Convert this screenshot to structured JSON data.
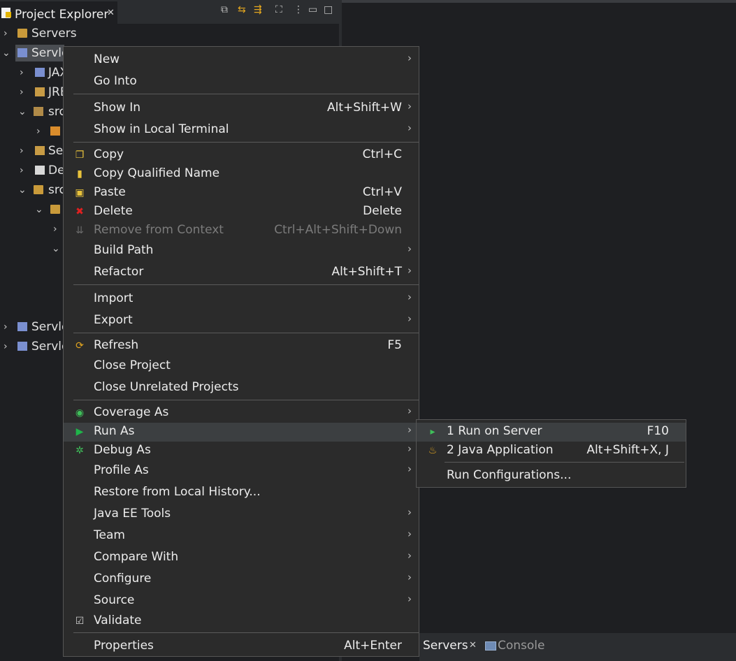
{
  "explorer": {
    "tab_label": "Project Explorer",
    "tree": [
      {
        "label": "Servers",
        "chev": "›"
      },
      {
        "label": "Servle",
        "chev": "⌄"
      },
      {
        "label": "JAX",
        "chev": "›"
      },
      {
        "label": "JRE",
        "chev": "›"
      },
      {
        "label": "src",
        "chev": "⌄"
      },
      {
        "label": "",
        "chev": "›"
      },
      {
        "label": "Se",
        "chev": "›"
      },
      {
        "label": "De",
        "chev": "›"
      },
      {
        "label": "src",
        "chev": "⌄"
      },
      {
        "label": "",
        "chev": "⌄"
      },
      {
        "label": "",
        "chev": "›"
      },
      {
        "label": "",
        "chev": "⌄"
      },
      {
        "label": "Servle",
        "chev": "›"
      },
      {
        "label": "Servle",
        "chev": "›"
      }
    ]
  },
  "context_menu": {
    "items": [
      {
        "label": "New",
        "shortcut": "",
        "arrow": "›"
      },
      {
        "label": "Go Into",
        "shortcut": "",
        "arrow": ""
      },
      {
        "label": "Show In",
        "shortcut": "Alt+Shift+W",
        "arrow": "›"
      },
      {
        "label": "Show in Local Terminal",
        "shortcut": "",
        "arrow": "›"
      },
      {
        "label": "Copy",
        "shortcut": "Ctrl+C",
        "arrow": ""
      },
      {
        "label": "Copy Qualified Name",
        "shortcut": "",
        "arrow": ""
      },
      {
        "label": "Paste",
        "shortcut": "Ctrl+V",
        "arrow": ""
      },
      {
        "label": "Delete",
        "shortcut": "Delete",
        "arrow": ""
      },
      {
        "label": "Remove from Context",
        "shortcut": "Ctrl+Alt+Shift+Down",
        "arrow": ""
      },
      {
        "label": "Build Path",
        "shortcut": "",
        "arrow": "›"
      },
      {
        "label": "Refactor",
        "shortcut": "Alt+Shift+T",
        "arrow": "›"
      },
      {
        "label": "Import",
        "shortcut": "",
        "arrow": "›"
      },
      {
        "label": "Export",
        "shortcut": "",
        "arrow": "›"
      },
      {
        "label": "Refresh",
        "shortcut": "F5",
        "arrow": ""
      },
      {
        "label": "Close Project",
        "shortcut": "",
        "arrow": ""
      },
      {
        "label": "Close Unrelated Projects",
        "shortcut": "",
        "arrow": ""
      },
      {
        "label": "Coverage As",
        "shortcut": "",
        "arrow": "›"
      },
      {
        "label": "Run As",
        "shortcut": "",
        "arrow": "›"
      },
      {
        "label": "Debug As",
        "shortcut": "",
        "arrow": "›"
      },
      {
        "label": "Profile As",
        "shortcut": "",
        "arrow": "›"
      },
      {
        "label": "Restore from Local History...",
        "shortcut": "",
        "arrow": ""
      },
      {
        "label": "Java EE Tools",
        "shortcut": "",
        "arrow": "›"
      },
      {
        "label": "Team",
        "shortcut": "",
        "arrow": "›"
      },
      {
        "label": "Compare With",
        "shortcut": "",
        "arrow": "›"
      },
      {
        "label": "Configure",
        "shortcut": "",
        "arrow": "›"
      },
      {
        "label": "Source",
        "shortcut": "",
        "arrow": "›"
      },
      {
        "label": "Validate",
        "shortcut": "",
        "arrow": ""
      },
      {
        "label": "Properties",
        "shortcut": "Alt+Enter",
        "arrow": ""
      }
    ]
  },
  "submenu": {
    "items": [
      {
        "label": "1 Run on Server",
        "shortcut": "F10"
      },
      {
        "label": "2 Java Application",
        "shortcut": "Alt+Shift+X, J"
      },
      {
        "label": "Run Configurations...",
        "shortcut": ""
      }
    ]
  },
  "bottom_tabs": {
    "servers": "Servers",
    "console": "Console"
  },
  "colors": {
    "menu_bg": "#2b2b2b",
    "highlight": "#3c3f41",
    "background": "#1e1f22",
    "accent": "#e3a61f"
  }
}
